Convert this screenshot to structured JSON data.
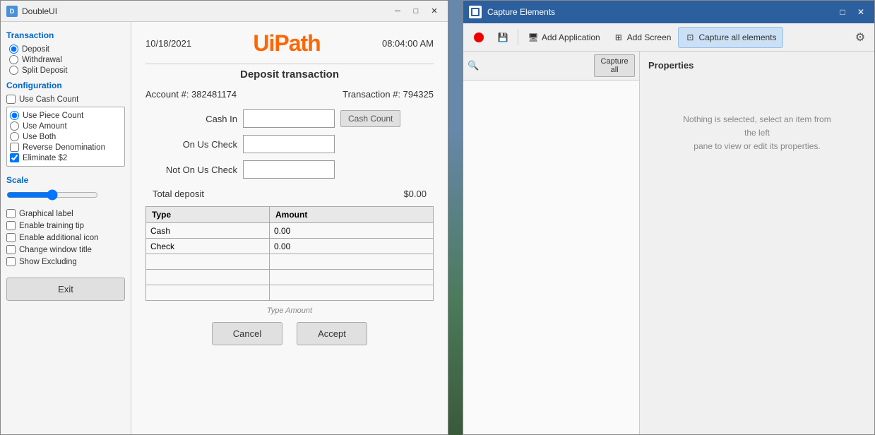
{
  "left_window": {
    "title": "DoubleUI",
    "controls": [
      "─",
      "□",
      "✕"
    ]
  },
  "top_bar": {
    "date": "10/18/2021",
    "brand": "UiPath",
    "time": "08:04:00 AM"
  },
  "section_title": "Deposit transaction",
  "account_info": {
    "account": "Account #: 382481174",
    "transaction": "Transaction #: 794325"
  },
  "form_fields": [
    {
      "label": "Cash In",
      "placeholder": ""
    },
    {
      "label": "On Us Check",
      "placeholder": ""
    },
    {
      "label": "Not On Us Check",
      "placeholder": ""
    }
  ],
  "cash_count_btn": "Cash Count",
  "total_label": "Total deposit",
  "total_amount": "$0.00",
  "table": {
    "headers": [
      "Type",
      "Amount"
    ],
    "rows": [
      {
        "type": "Cash",
        "amount": "0.00"
      },
      {
        "type": "Check",
        "amount": "0.00"
      },
      {
        "type": "",
        "amount": ""
      },
      {
        "type": "",
        "amount": ""
      }
    ]
  },
  "bottom_note": "Type Amount",
  "buttons": {
    "cancel": "Cancel",
    "accept": "Accept"
  },
  "sidebar": {
    "transaction_label": "Transaction",
    "transaction_options": [
      "Deposit",
      "Withdrawal",
      "Split Deposit"
    ],
    "transaction_selected": "Deposit",
    "configuration_label": "Configuration",
    "config_checkboxes": [
      {
        "label": "Use Cash Count",
        "checked": false
      }
    ],
    "config_radio_group": [
      {
        "label": "Use Piece Count",
        "selected": true
      },
      {
        "label": "Use Amount",
        "selected": false
      },
      {
        "label": "Use Both",
        "selected": false
      }
    ],
    "config_extra": [
      {
        "label": "Reverse Denomination",
        "checked": false
      },
      {
        "label": "Eliminate $2",
        "checked": true
      }
    ],
    "scale_label": "Scale",
    "checkboxes": [
      {
        "label": "Graphical label",
        "checked": false
      },
      {
        "label": "Enable training tip",
        "checked": false
      },
      {
        "label": "Enable additional icon",
        "checked": false
      },
      {
        "label": "Change window title",
        "checked": false
      },
      {
        "label": "Show Excluding",
        "checked": false
      }
    ],
    "exit_btn": "Exit"
  },
  "right_window": {
    "title": "Capture Elements",
    "controls": [
      "□",
      "✕"
    ],
    "toolbar": {
      "record_btn": "",
      "save_btn": "",
      "add_app_btn": "Add Application",
      "add_screen_btn": "Add Screen",
      "capture_all_btn": "Capture all elements",
      "capture_all_search": "Capture all"
    },
    "properties_header": "Properties",
    "empty_msg_line1": "Nothing is selected, select an item from the left",
    "empty_msg_line2": "pane to view or edit its properties."
  }
}
